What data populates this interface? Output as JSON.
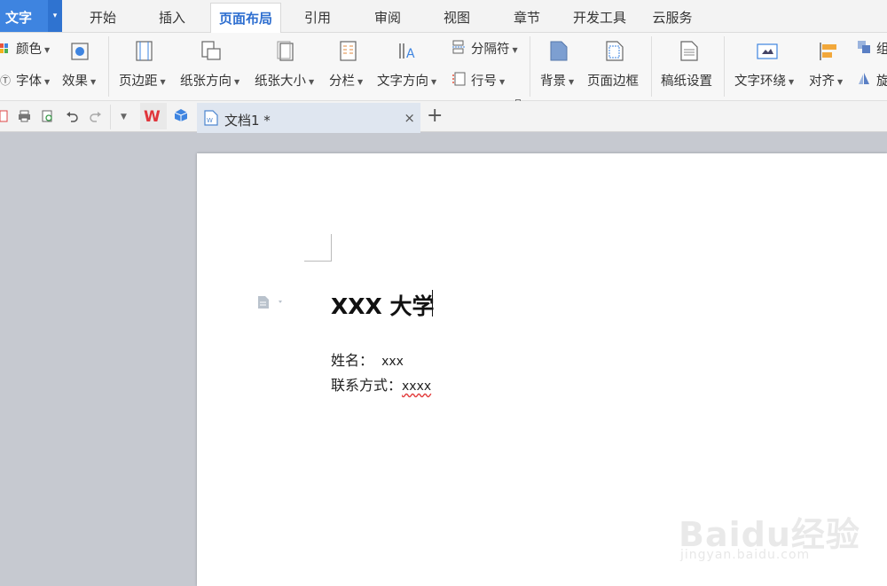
{
  "app_button": {
    "label": "文字",
    "arrow": "▾"
  },
  "menu_tabs": [
    "开始",
    "插入",
    "页面布局",
    "引用",
    "审阅",
    "视图",
    "章节",
    "开发工具",
    "云服务"
  ],
  "active_tab": "页面布局",
  "ribbon": {
    "color": "颜色",
    "font": "字体",
    "effect": "效果",
    "margins": "页边距",
    "orientation": "纸张方向",
    "size": "纸张大小",
    "columns": "分栏",
    "text_direction": "文字方向",
    "breaks": "分隔符",
    "line_numbers": "行号",
    "background": "背景",
    "page_border": "页面边框",
    "grid_paper": "稿纸设置",
    "wrap_text": "文字环绕",
    "align": "对齐",
    "group_partial": "组",
    "rotate_partial": "旋"
  },
  "tabs_bar": {
    "doc_tab_name": "文档1 *",
    "close": "×",
    "new_tab": "+"
  },
  "document": {
    "title": "XXX 大学",
    "name_label": "姓名：",
    "name_value": "xxx",
    "contact_label": "联系方式：",
    "contact_value": "xxxx"
  },
  "watermark": {
    "brand": "Baidu经验",
    "url": "jingyan.baidu.com"
  },
  "colors": {
    "accent": "#3e84e0",
    "active_tab_text": "#2f6fd0",
    "canvas": "#c6c9d0"
  }
}
